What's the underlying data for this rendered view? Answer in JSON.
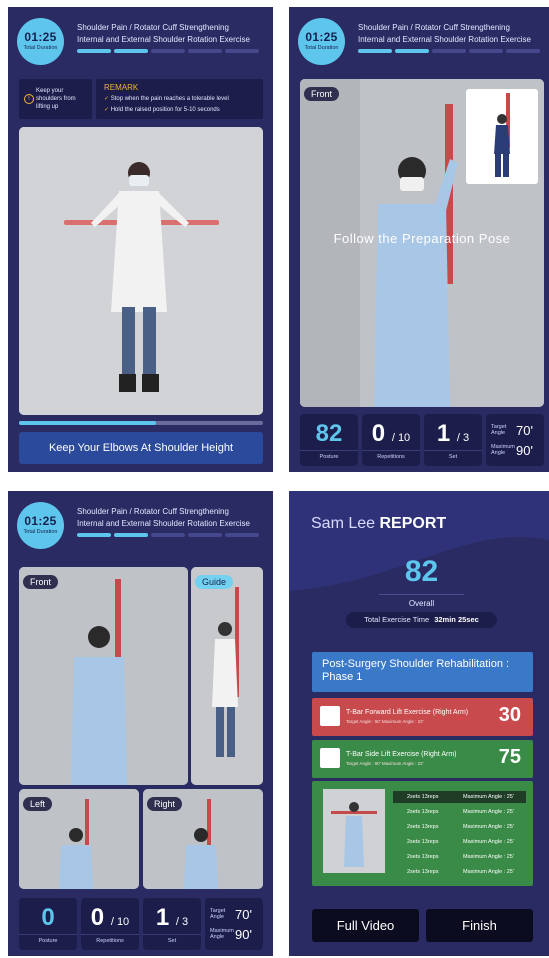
{
  "header": {
    "timer": "01:25",
    "timer_label": "Total Duration",
    "title_line1": "Shoulder Pain / Rotator Cuff Strengthening",
    "title_line2": "Internal and External Shoulder Rotation Exercise",
    "progress_steps_total": 5,
    "progress_steps_done": 2
  },
  "screen1": {
    "note_left": "Keep your shoulders from lifting up",
    "remark_title": "REMARK",
    "remark_items": [
      "Stop when the pain reaches a tolerable level",
      "Hold the raised position for 5-10 seconds"
    ],
    "video_progress": 0.56,
    "banner": "Keep Your Elbows At Shoulder Height"
  },
  "screen2": {
    "tag_front": "Front",
    "overlay_text": "Follow the Preparation Pose",
    "posture": "82",
    "posture_label": "Posture",
    "repetitions": "0",
    "repetitions_total": "/ 10",
    "repetitions_label": "Repetitions",
    "set": "1",
    "set_total": "/ 3",
    "set_label": "Set",
    "target_angle_label": "Target Angle",
    "target_angle": "70'",
    "max_angle_label": "Maximum Angle",
    "max_angle": "90'"
  },
  "screen3": {
    "tag_front": "Front",
    "tag_guide": "Guide",
    "tag_left": "Left",
    "tag_right": "Right",
    "posture": "0",
    "posture_label": "Posture",
    "repetitions": "0",
    "repetitions_total": "/ 10",
    "repetitions_label": "Repetitions",
    "set": "1",
    "set_total": "/ 3",
    "set_label": "Set",
    "target_angle_label": "Target Angle",
    "target_angle": "70'",
    "max_angle_label": "Maximum Angle",
    "max_angle": "90'"
  },
  "report": {
    "name": "Sam Lee",
    "title": "REPORT",
    "score": "82",
    "overall_label": "Overall",
    "time_label": "Total Exercise Time",
    "time_value": "32min 25sec",
    "program": "Post-Surgery Shoulder Rehabilitation : Phase 1",
    "exercises": [
      {
        "name": "T-Bar Forward Lift Exercise (Right Arm)",
        "sub": "Target Angle : 90'   Maximum Angle : 22'",
        "score": "30"
      },
      {
        "name": "T-Bar Side Lift Exercise (Right Arm)",
        "sub": "Target Angle : 90'   Maximum Angle : 22'",
        "score": "75"
      }
    ],
    "rows": [
      {
        "sets": "2sets 13reps",
        "angle": "Maximum Angle : 25'"
      },
      {
        "sets": "2sets 13reps",
        "angle": "Maximum Angle : 25'"
      },
      {
        "sets": "2sets 13reps",
        "angle": "Maximum Angle : 25'"
      },
      {
        "sets": "2sets 13reps",
        "angle": "Maximum Angle : 25'"
      },
      {
        "sets": "2sets 13reps",
        "angle": "Maximum Angle : 25'"
      },
      {
        "sets": "2sets 13reps",
        "angle": "Maximum Angle : 25'"
      }
    ],
    "btn_video": "Full Video",
    "btn_finish": "Finish"
  }
}
